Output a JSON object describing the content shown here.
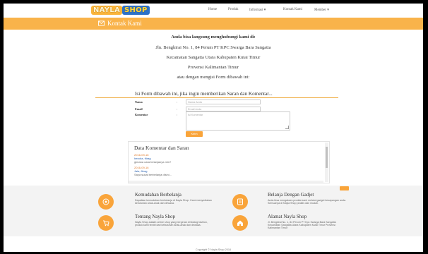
{
  "header": {
    "logo_part1": "NAYLA",
    "logo_part2": "SHOP",
    "nav": [
      {
        "label": "Home"
      },
      {
        "label": "Produk"
      },
      {
        "label": "Informasi ▾"
      },
      {
        "label": "Kontak Kami"
      },
      {
        "label": "Member ▾"
      }
    ]
  },
  "title_band": {
    "icon": "envelope-icon",
    "title": "Kontak Kami"
  },
  "contact": {
    "intro": "Anda bisa langsung menghubungi kami di:",
    "address_line1": "Jln. Bengkirai No. 1, 84 Perum PT KPC Swarga Bara Sangatta",
    "address_line2": "Kecamatan Sangatta Utara Kabupaten Kutai Timur",
    "address_line3": "Provensi Kalimantan Timur",
    "alt": "atau dengan mengisi Form dibawah ini:"
  },
  "form": {
    "heading": "Isi Form dibawah ini, jika ingin memberikan Saran dan Komentar...",
    "name_label": "Nama",
    "name_placeholder": "Nama Anda",
    "email_label": "Email",
    "email_placeholder": "Email Anda",
    "comment_label": "Komentar",
    "comment_placeholder": "Isi Komentar",
    "colon": ":",
    "submit_label": "Kirim"
  },
  "comments": {
    "title": "Data Komentar dan Saran",
    "items": [
      {
        "date": "2016-09-16",
        "name": "hendra, fitrag",
        "text": "gimana cara belanjanya min?"
      },
      {
        "date": "2016-09-16",
        "name": "Jala, fitrag",
        "text": "Saya sukal berbelanja disini..."
      }
    ]
  },
  "features": [
    {
      "icon": "target-icon",
      "title": "Kemudahan Berbelanja",
      "text": "Dapatkan kemudahan berbelanja di Nayla Shop. Kami menyediakan kebutuhan anak-anak dan dewasa."
    },
    {
      "icon": "gadget-icon",
      "title": "Belanja Dengan Gadjet",
      "text": "Anda bisa mengakses produk-kami melalui gadget kesayangan anda. Semuanya di Nayla Shop praktis dan mudah."
    },
    {
      "icon": "cart-icon",
      "title": "Tentang Nayla Shop",
      "text": "Nayla Shop adalah online shop yang bergerak di bidang fashion, produk kami terdiri dari kebutuhan anak-anak dan dewasa."
    },
    {
      "icon": "home-icon",
      "title": "Alamat Nayla Shop",
      "text": "Jl. Bengkirai No. 1, 84 Perum PT Kpc Swarga Bara Sangatta Kecamatan Sangatta Utara Kabupaten Kutai Timur Provensi Kalimantan Timur"
    }
  ],
  "footer": "Copyright © Nayla Shop 2016",
  "colors": {
    "accent": "#f9a43a",
    "band": "#f9b34a"
  }
}
